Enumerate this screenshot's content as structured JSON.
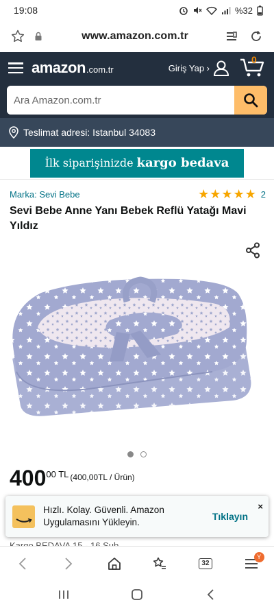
{
  "status_bar": {
    "time": "19:08",
    "battery": "%32"
  },
  "browser": {
    "url": "www.amazon.com.tr",
    "tab_count": "32",
    "menu_badge": "Y"
  },
  "header": {
    "logo_main": "amazon",
    "logo_tld": ".com.tr",
    "signin_label": "Giriş Yap ›",
    "cart_count": "0"
  },
  "search": {
    "placeholder": "Ara Amazon.com.tr"
  },
  "delivery": {
    "label": "Teslimat adresi: Istanbul 34083"
  },
  "banner": {
    "text_regular": "İlk siparişinizde",
    "text_bold": "kargo bedava"
  },
  "product": {
    "brand": "Marka: Sevi Bebe",
    "rating_stars": 5,
    "rating_count": "2",
    "title": "Sevi Bebe Anne Yanı Bebek Reflü Yatağı Mavi Yıldız",
    "image_count": 2,
    "image_active": 0,
    "price_whole": "400",
    "price_fraction": "00 TL",
    "price_unit": "(400,00TL / Ürün)"
  },
  "toast": {
    "message": "Hızlı. Kolay. Güvenli. Amazon Uygulamasını Yükleyin.",
    "cta": "Tıklayın",
    "close": "×"
  },
  "partial_line": "Kargo BEDAVA 15 - 16 Şub",
  "colors": {
    "amazon_dark": "#232f3e",
    "delivery_bar": "#37475a",
    "search_button": "#febd69",
    "banner_teal": "#00878f",
    "link": "#007185",
    "star": "#f7a600"
  }
}
